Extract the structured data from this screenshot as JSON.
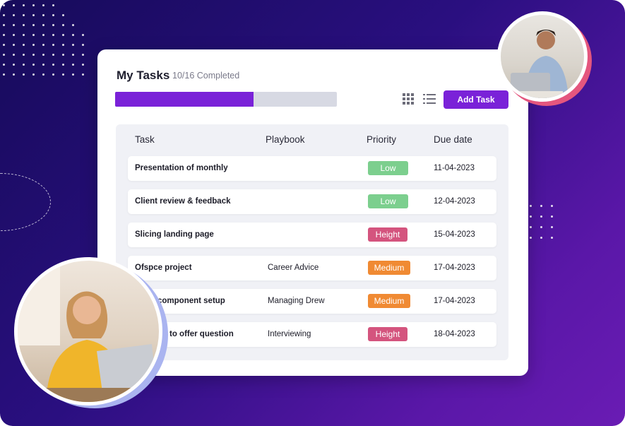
{
  "header": {
    "title": "My Tasks",
    "completed": "10/16 Completed",
    "progress": 0.625,
    "add_task_label": "Add Task"
  },
  "table": {
    "columns": [
      "Task",
      "Playbook",
      "Priority",
      "Due date"
    ],
    "rows": [
      {
        "task": "Presentation of monthly",
        "playbook": "",
        "priority": "Low",
        "due": "11-04-2023"
      },
      {
        "task": "Client review & feedback",
        "playbook": "",
        "priority": "Low",
        "due": "12-04-2023"
      },
      {
        "task": "Slicing landing page",
        "playbook": "",
        "priority": "Height",
        "due": "15-04-2023"
      },
      {
        "task": "Ofspce project",
        "playbook": "Career Advice",
        "priority": "Medium",
        "due": "17-04-2023"
      },
      {
        "task": "component setup",
        "playbook": "Managing Drew",
        "priority": "Medium",
        "due": "17-04-2023"
      },
      {
        "task": "to offer question",
        "playbook": "Interviewing",
        "priority": "Height",
        "due": "18-04-2023"
      }
    ]
  },
  "colors": {
    "accent": "#7a22d8",
    "low": "#7ccf8e",
    "height": "#d4547e",
    "medium": "#f08a33"
  },
  "icons": [
    "grid-view-icon",
    "list-view-icon"
  ]
}
